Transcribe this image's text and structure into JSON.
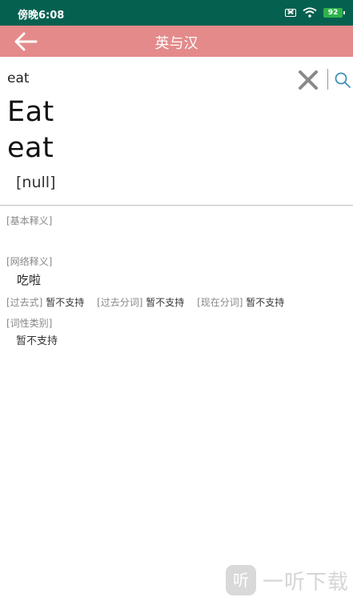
{
  "status_bar": {
    "time": "傍晚6:08",
    "battery": "92"
  },
  "app_bar": {
    "title": "英与汉"
  },
  "search": {
    "value": "eat"
  },
  "word": {
    "title": "Eat",
    "lower": "eat",
    "phonetic": "[null]"
  },
  "sections": {
    "basic_label": "[基本释义]",
    "network_label": "[网络释义]",
    "network_value": "吃啦",
    "forms": {
      "past_label": "[过去式]",
      "past_value": "暂不支持",
      "past_participle_label": "[过去分词]",
      "past_participle_value": "暂不支持",
      "present_participle_label": "[现在分词]",
      "present_participle_value": "暂不支持"
    },
    "pos_label": "[词性类别]",
    "pos_value": "暂不支持"
  },
  "watermark": {
    "logo": "听",
    "text": "一听下载"
  },
  "colors": {
    "status_bar": "#06604f",
    "app_bar": "#e48a8a",
    "battery": "#2fb24a"
  }
}
